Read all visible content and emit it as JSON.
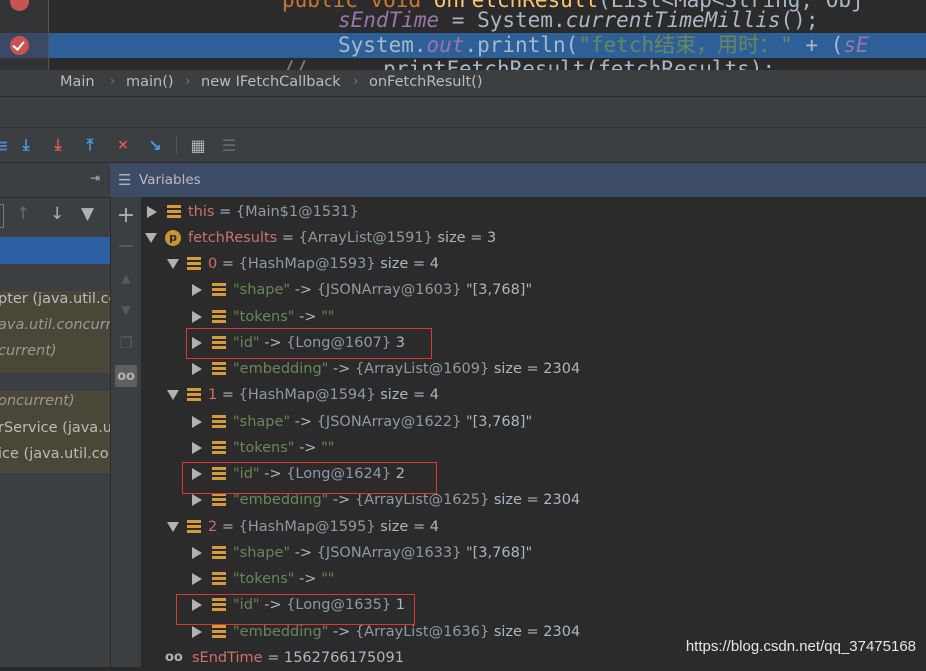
{
  "editor": {
    "line1": {
      "kw1": "public",
      "kw2": "void",
      "method": "onFetchResult",
      "rest": "(List<Map<String, Obj"
    },
    "line2": {
      "field": "sEndTime",
      "mid": " = System.",
      "call": "currentTimeMillis",
      "end": "();"
    },
    "line3": {
      "start": "System.",
      "field": "out",
      "mid": ".println(",
      "str": "\"fetch结束，用时：\"",
      "end": " + (",
      "field2": "sE"
    },
    "line4": {
      "comment": "//",
      "text": "printFetchResult(fetchResults);"
    }
  },
  "breadcrumb": [
    "Main",
    "main()",
    "new IFetchCallback",
    "onFetchResult()"
  ],
  "variables_panel": {
    "title": "Variables"
  },
  "frames": [
    {
      "text": "pter (java.util.co"
    },
    {
      "text": "ava.util.concurre"
    },
    {
      "text": "current)"
    },
    {
      "text": "oncurrent)"
    },
    {
      "text": "rService (java.u"
    },
    {
      "text": "ice (java.util.co"
    }
  ],
  "tree": {
    "this": {
      "name": "this",
      "ref": "{Main$1@1531}"
    },
    "fetchResults": {
      "name": "fetchResults",
      "ref": "{ArrayList@1591}",
      "size": "size = 3"
    },
    "items": [
      {
        "name": "0",
        "ref": "{HashMap@1593}",
        "size": "size = 4",
        "entries": [
          {
            "key": "\"shape\"",
            "ref": "{JSONArray@1603}",
            "val": "\"[3,768]\""
          },
          {
            "key": "\"tokens\"",
            "ref": "",
            "val": "\"\""
          },
          {
            "key": "\"id\"",
            "ref": "{Long@1607}",
            "val": "3"
          },
          {
            "key": "\"embedding\"",
            "ref": "{ArrayList@1609}",
            "val": "size = 2304"
          }
        ]
      },
      {
        "name": "1",
        "ref": "{HashMap@1594}",
        "size": "size = 4",
        "entries": [
          {
            "key": "\"shape\"",
            "ref": "{JSONArray@1622}",
            "val": "\"[3,768]\""
          },
          {
            "key": "\"tokens\"",
            "ref": "",
            "val": "\"\""
          },
          {
            "key": "\"id\"",
            "ref": "{Long@1624}",
            "val": "2"
          },
          {
            "key": "\"embedding\"",
            "ref": "{ArrayList@1625}",
            "val": "size = 2304"
          }
        ]
      },
      {
        "name": "2",
        "ref": "{HashMap@1595}",
        "size": "size = 4",
        "entries": [
          {
            "key": "\"shape\"",
            "ref": "{JSONArray@1633}",
            "val": "\"[3,768]\""
          },
          {
            "key": "\"tokens\"",
            "ref": "",
            "val": "\"\""
          },
          {
            "key": "\"id\"",
            "ref": "{Long@1635}",
            "val": "1"
          },
          {
            "key": "\"embedding\"",
            "ref": "{ArrayList@1636}",
            "val": "size = 2304"
          }
        ]
      }
    ],
    "sEndTime": {
      "name": "sEndTime",
      "val": "1562766175091"
    }
  },
  "arrow": "->",
  "equals": "=",
  "watermark": "https://blog.csdn.net/qq_37475168"
}
